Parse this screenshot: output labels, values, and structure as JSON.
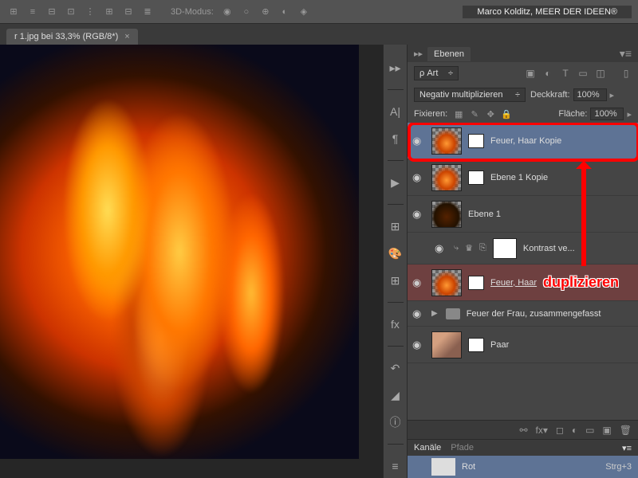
{
  "topbar": {
    "mode_label": "3D-Modus:",
    "credit": "Marco Kolditz, MEER DER IDEEN®"
  },
  "tab": {
    "title": "r 1.jpg bei 33,3% (RGB/8*)",
    "close": "×"
  },
  "panels": {
    "layers_title": "Ebenen",
    "filter_kind": "ρ Art",
    "filter_dd": "÷",
    "blend_mode": "Negativ multiplizieren",
    "opacity_label": "Deckkraft:",
    "opacity_value": "100%",
    "fill_label": "Fläche:",
    "fill_value": "100%",
    "lock_label": "Fixieren:"
  },
  "layers": [
    {
      "name": "Feuer, Haar Kopie",
      "selected": true
    },
    {
      "name": "Ebene 1 Kopie"
    },
    {
      "name": "Ebene 1"
    },
    {
      "name": "Kontrast ve...",
      "adjustment": true
    },
    {
      "name": "Feuer, Haar",
      "red": true
    },
    {
      "name": "Feuer der Frau, zusammengefasst",
      "folder": true
    },
    {
      "name": "Paar"
    }
  ],
  "channels": {
    "tab1": "Kanäle",
    "tab2": "Pfade",
    "row_name": "Rot",
    "row_shortcut": "Strg+3"
  },
  "annotation": {
    "text": "duplizieren"
  }
}
